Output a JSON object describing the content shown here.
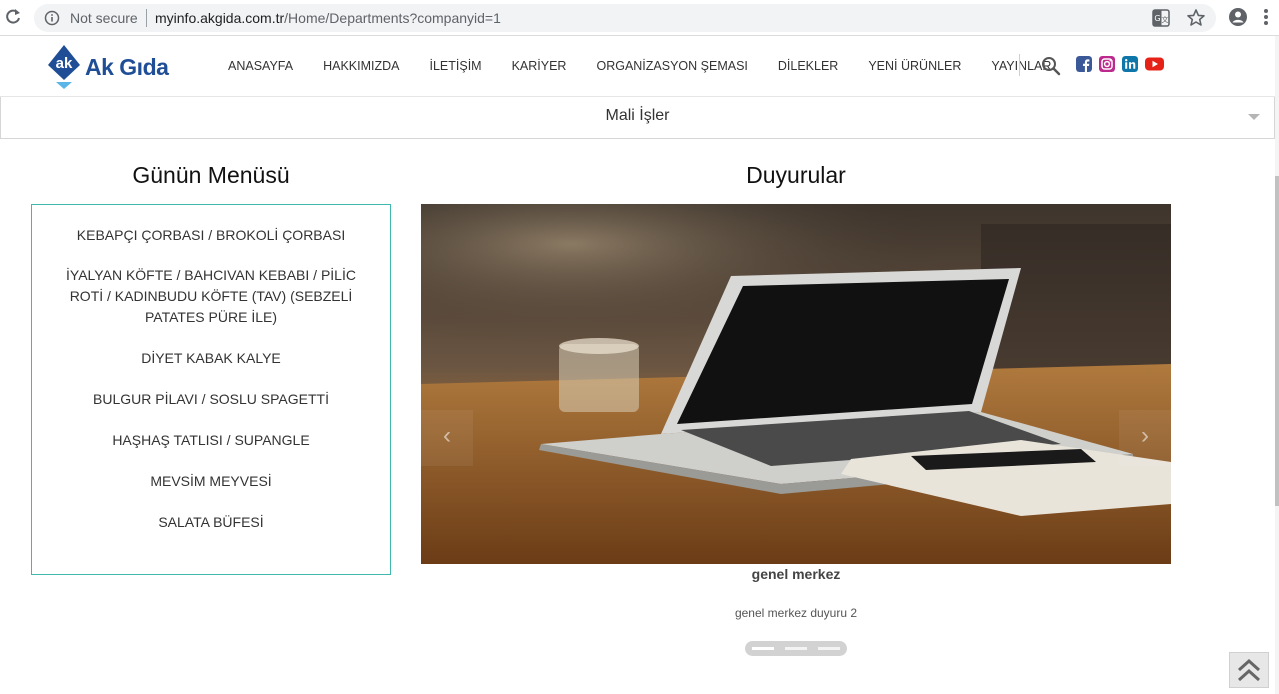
{
  "browser": {
    "security_label": "Not secure",
    "url_host": "myinfo.akgida.com.tr",
    "url_path": "/Home/Departments?companyid=1"
  },
  "header": {
    "logo_mark": "ak",
    "logo_text": "Ak Gıda",
    "nav": [
      "ANASAYFA",
      "HAKKIMIZDA",
      "İLETİŞİM",
      "KARİYER",
      "ORGANİZASYON ŞEMASI",
      "DİLEKLER",
      "YENİ ÜRÜNLER",
      "YAYINLAR"
    ],
    "icons": [
      "search-icon",
      "facebook-icon",
      "instagram-icon",
      "linkedin-icon",
      "youtube-icon"
    ],
    "colors": {
      "facebook": "#3b5998",
      "instagram": "#bc2a8d",
      "linkedin": "#0e76a8",
      "youtube": "#e62117"
    }
  },
  "department": {
    "selected": "Mali İşler"
  },
  "menu": {
    "title": "Günün Menüsü",
    "items": [
      "KEBAPÇI ÇORBASI / BROKOLİ ÇORBASI",
      "İYALYAN KÖFTE / BAHCIVAN KEBABI / PİLİC ROTİ / KADINBUDU KÖFTE (TAV) (SEBZELİ PATATES PÜRE İLE)",
      "DİYET KABAK KALYE",
      "BULGUR PİLAVI / SOSLU SPAGETTİ",
      "HAŞHAŞ TATLISI / SUPANGLE",
      "MEVSİM MEYVESİ",
      "SALATA BÜFESİ"
    ],
    "border_color": "#3fb9ad"
  },
  "announcements": {
    "title": "Duyurular",
    "slide_title": "genel merkez",
    "slide_text": "genel merkez duyuru 2",
    "slide_count": 3,
    "active_slide": 1,
    "prev_icon": "chevron-left-icon",
    "next_icon": "chevron-right-icon"
  }
}
